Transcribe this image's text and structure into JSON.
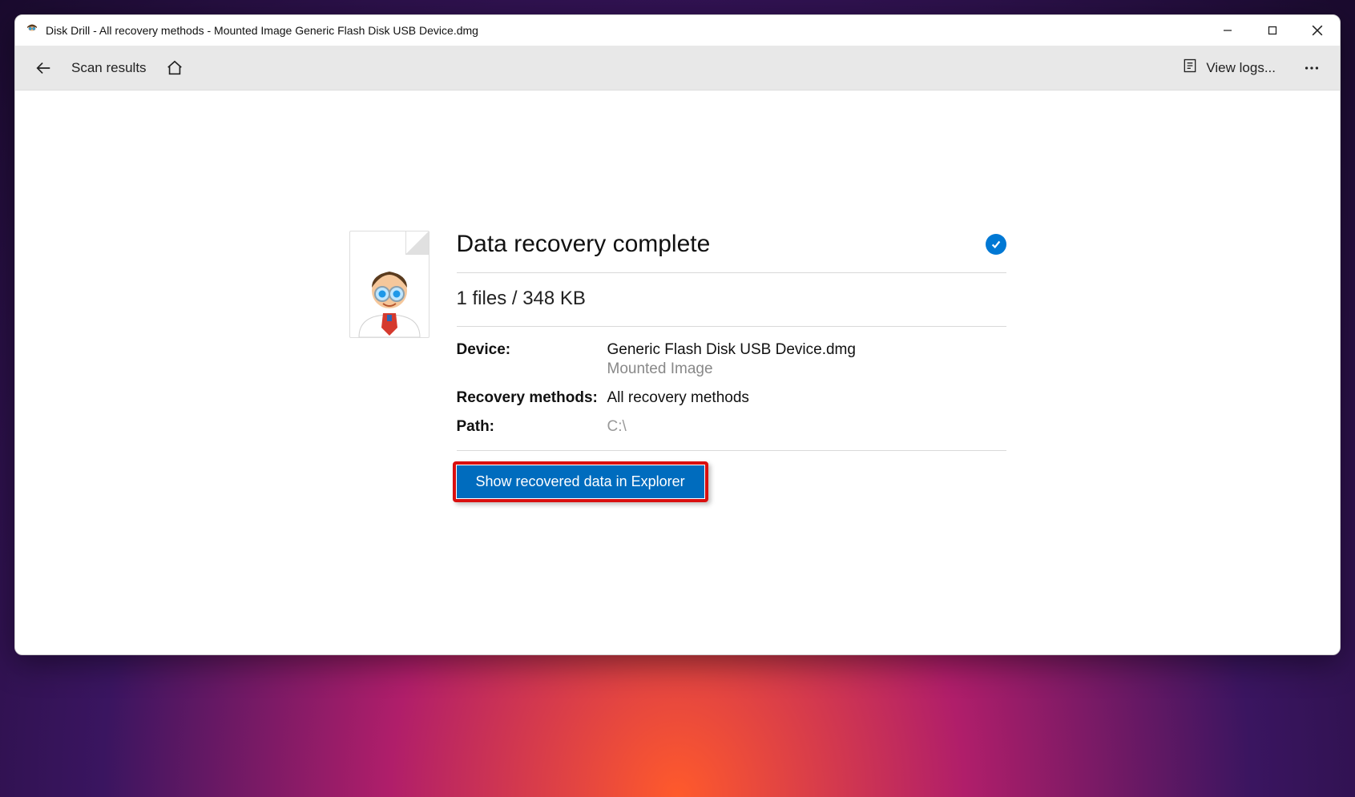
{
  "window": {
    "title": "Disk Drill - All recovery methods - Mounted Image Generic Flash Disk USB Device.dmg"
  },
  "toolbar": {
    "back_label": "Scan results",
    "view_logs": "View logs..."
  },
  "result": {
    "heading": "Data recovery complete",
    "summary": "1 files / 348 KB",
    "device_label": "Device:",
    "device_value": "Generic Flash Disk USB Device.dmg",
    "device_sub": "Mounted Image",
    "methods_label": "Recovery methods:",
    "methods_value": "All recovery methods",
    "path_label": "Path:",
    "path_value": "C:\\",
    "cta": "Show recovered data in Explorer"
  }
}
